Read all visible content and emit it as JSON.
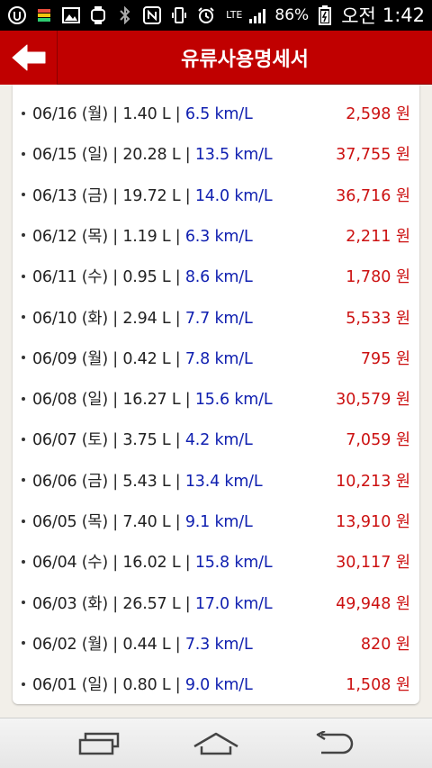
{
  "status_bar": {
    "battery": "86%",
    "ampm": "오전",
    "time": "1:42",
    "network": "LTE"
  },
  "header": {
    "title": "유류사용명세서",
    "back_icon": "arrow-left-icon"
  },
  "records": [
    {
      "label": "06/16 (월) | 1.40 L | ",
      "efficiency": "6.5 km/L",
      "amount": "2,598 원"
    },
    {
      "label": "06/15 (일) | 20.28 L | ",
      "efficiency": "13.5 km/L",
      "amount": "37,755 원"
    },
    {
      "label": "06/13 (금) | 19.72 L | ",
      "efficiency": "14.0 km/L",
      "amount": "36,716 원"
    },
    {
      "label": "06/12 (목) | 1.19 L | ",
      "efficiency": "6.3 km/L",
      "amount": "2,211 원"
    },
    {
      "label": "06/11 (수) | 0.95 L | ",
      "efficiency": "8.6 km/L",
      "amount": "1,780 원"
    },
    {
      "label": "06/10 (화) | 2.94 L | ",
      "efficiency": "7.7 km/L",
      "amount": "5,533 원"
    },
    {
      "label": "06/09 (월) | 0.42 L | ",
      "efficiency": "7.8 km/L",
      "amount": "795 원"
    },
    {
      "label": "06/08 (일) | 16.27 L | ",
      "efficiency": "15.6 km/L",
      "amount": "30,579 원"
    },
    {
      "label": "06/07 (토) | 3.75 L | ",
      "efficiency": "4.2 km/L",
      "amount": "7,059 원"
    },
    {
      "label": "06/06 (금) | 5.43 L | ",
      "efficiency": "13.4 km/L",
      "amount": "10,213 원"
    },
    {
      "label": "06/05 (목) | 7.40 L | ",
      "efficiency": "9.1 km/L",
      "amount": "13,910 원"
    },
    {
      "label": "06/04 (수) | 16.02 L | ",
      "efficiency": "15.8 km/L",
      "amount": "30,117 원"
    },
    {
      "label": "06/03 (화) | 26.57 L | ",
      "efficiency": "17.0 km/L",
      "amount": "49,948 원"
    },
    {
      "label": "06/02 (월) | 0.44 L | ",
      "efficiency": "7.3 km/L",
      "amount": "820 원"
    },
    {
      "label": "06/01 (일) | 0.80 L | ",
      "efficiency": "9.0 km/L",
      "amount": "1,508 원"
    }
  ],
  "nav_bar": {
    "recent_icon": "recent-apps-icon",
    "home_icon": "home-icon",
    "back_icon": "back-icon"
  },
  "colors": {
    "header": "#c00000",
    "efficiency": "#1020b0",
    "amount": "#cc1111"
  }
}
